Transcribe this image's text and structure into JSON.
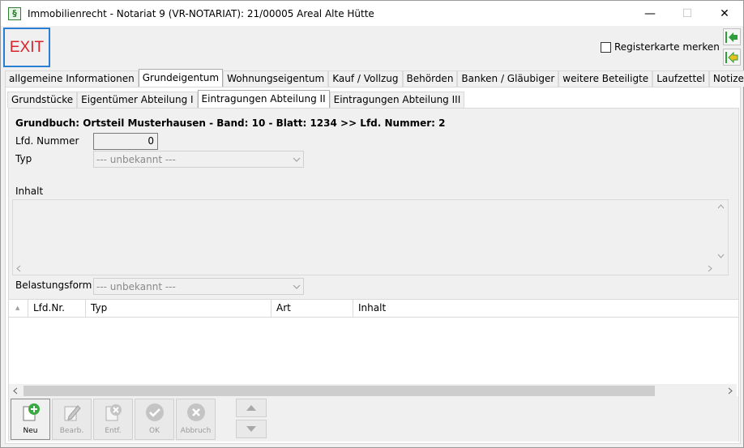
{
  "window": {
    "title": "Immobilienrecht - Notariat 9 (VR-NOTARIAT): 21/00005 Areal Alte Hütte",
    "app_icon_glyph": "§",
    "minimize_glyph": "—",
    "maximize_glyph": "☐",
    "close_glyph": "✕"
  },
  "toolbar": {
    "exit_label": "EXIT",
    "register_label": "Registerkarte merken",
    "nav_back_icon": "green-arrow-left-icon",
    "nav_alt_icon": "green-arrow-left-alt-icon"
  },
  "main_tabs": [
    {
      "label": "allgemeine Informationen"
    },
    {
      "label": "Grundeigentum"
    },
    {
      "label": "Wohnungseigentum"
    },
    {
      "label": "Kauf / Vollzug"
    },
    {
      "label": "Behörden"
    },
    {
      "label": "Banken / Gläubiger"
    },
    {
      "label": "weitere Beteiligte"
    },
    {
      "label": "Laufzettel"
    },
    {
      "label": "Notizen"
    }
  ],
  "sub_tabs": [
    {
      "label": "Grundstücke"
    },
    {
      "label": "Eigentümer Abteilung I"
    },
    {
      "label": "Eintragungen Abteilung II"
    },
    {
      "label": "Eintragungen Abteilung III"
    }
  ],
  "form": {
    "heading": "Grundbuch: Ortsteil Musterhausen - Band: 10 - Blatt: 1234 >> Lfd. Nummer: 2",
    "lfd_label": "Lfd. Nummer",
    "lfd_value": "0",
    "typ_label": "Typ",
    "typ_value": "--- unbekannt ---",
    "inhalt_label": "Inhalt",
    "belastung_label": "Belastungsform",
    "belastung_value": "--- unbekannt ---"
  },
  "table": {
    "sort_glyph": "▲",
    "columns": [
      "Lfd.Nr.",
      "Typ",
      "Art",
      "Inhalt"
    ]
  },
  "bottom_buttons": [
    {
      "label": "Neu",
      "icon": "plus-icon",
      "glyph": "+"
    },
    {
      "label": "Bearb.",
      "icon": "pencil-icon",
      "glyph": "✎"
    },
    {
      "label": "Entf.",
      "icon": "delete-icon",
      "glyph": "✕"
    },
    {
      "label": "OK",
      "icon": "check-icon",
      "glyph": "✓"
    },
    {
      "label": "Abbruch",
      "icon": "cancel-icon",
      "glyph": "✕"
    }
  ],
  "colors": {
    "exit_text": "#d8232a",
    "focus_border": "#2a7fd4",
    "nav_green": "#2e9e3b",
    "plus_green": "#3aa843"
  }
}
